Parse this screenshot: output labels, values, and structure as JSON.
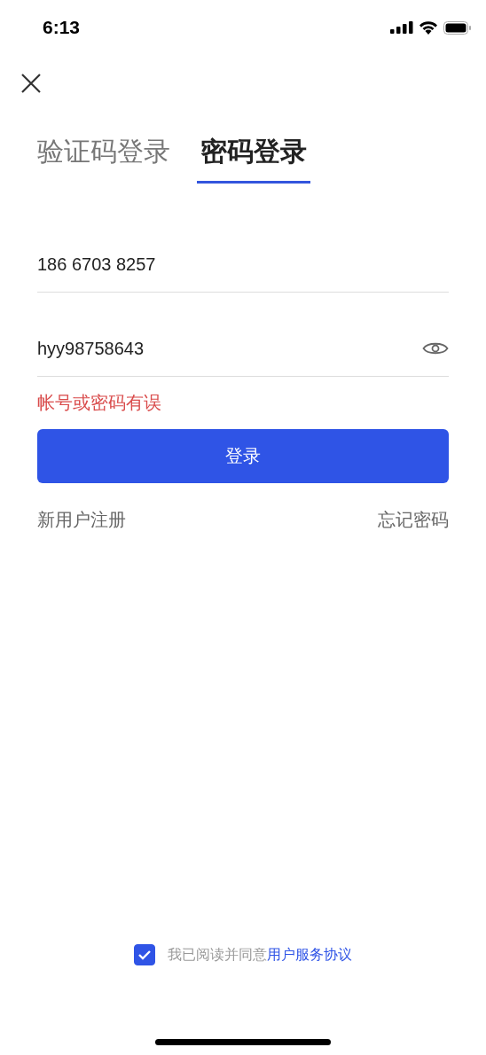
{
  "status_bar": {
    "time": "6:13"
  },
  "tabs": [
    {
      "label": "验证码登录",
      "selected": false
    },
    {
      "label": "密码登录",
      "selected": true
    }
  ],
  "phone_field": {
    "value": "186 6703 8257"
  },
  "password_field": {
    "value": "hyy98758643",
    "visible": true
  },
  "error": "帐号或密码有误",
  "login_button": "登录",
  "links": [
    "新用户注册",
    "忘记密码"
  ],
  "agreement": {
    "checked": true,
    "text": "我已阅读并同意",
    "link": "用户服务协议"
  }
}
